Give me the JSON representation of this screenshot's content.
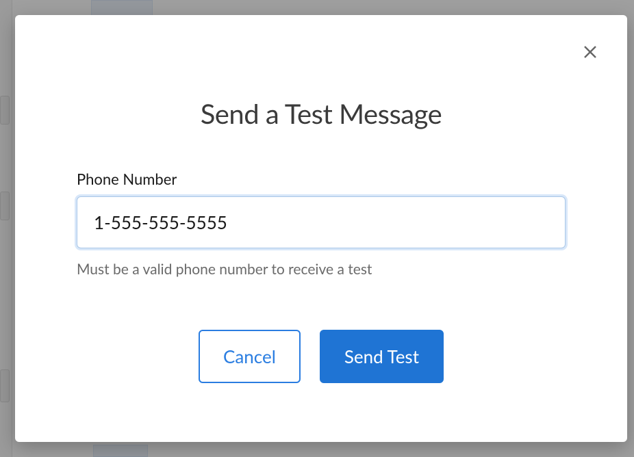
{
  "modal": {
    "title": "Send a Test Message",
    "phone_label": "Phone Number",
    "phone_value": "1-555-555-5555",
    "help_text": "Must be a valid phone number to receive a test",
    "cancel_label": "Cancel",
    "submit_label": "Send Test"
  }
}
